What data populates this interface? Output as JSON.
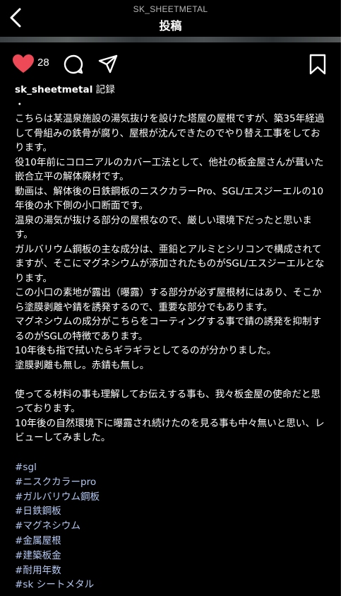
{
  "header": {
    "username": "SK_SHEETMETAL",
    "title": "投稿"
  },
  "actions": {
    "like_count": "28",
    "like_color": "#ed4956"
  },
  "caption": {
    "username": "sk_sheetmetal",
    "label": " 記録",
    "body": "・\nこちらは某温泉施設の湯気抜けを設けた塔屋の屋根ですが、築35年経過して骨組みの鉄骨が腐り、屋根が沈んできたのでやり替え工事をしております。\n役10年前にコロニアルのカバー工法として、他社の板金屋さんが葺いた嵌合立平の解体廃材です。\n動画は、解体後の日鉄鋼板のニスクカラーPro、SGL/エスジーエルの10年後の水下側の小口断面です。\n温泉の湯気が抜ける部分の屋根なので、厳しい環境下だったと思います。\nガルバリウム鋼板の主な成分は、亜鉛とアルミとシリコンで構成されてますが、そこにマグネシウムが添加されたものがSGL/エスジーエルとなります。\nこの小口の素地が露出（曝露）する部分が必ず屋根材にはあり、そこから塗膜剥離や錆を誘発するので、重要な部分でもあります。\nマグネシウムの成分がこちらをコーティングする事で錆の誘発を抑制するのがSGLの特徴であります。\n10年後も指で拭いたらギラギラとしてるのが分かりました。\n塗膜剥離も無し。赤錆も無し。\n\n使ってる材料の事も理解してお伝えする事も、我々板金屋の使命だと思っております。\n10年後の自然環境下に曝露され続けたのを見る事も中々無いと思い、レビューしてみました。"
  },
  "hashtags": [
    "#sgl",
    "#ニスクカラーpro",
    "#ガルバリウム鋼板",
    "#日鉄鋼板",
    "#マグネシウム",
    "#金属屋根",
    "#建築板金",
    "#耐用年数",
    "#sk シートメタル"
  ],
  "colors": {
    "background": "#000000",
    "text": "#ffffff",
    "hashtag": "#b4c8f2",
    "like": "#ed4956"
  }
}
